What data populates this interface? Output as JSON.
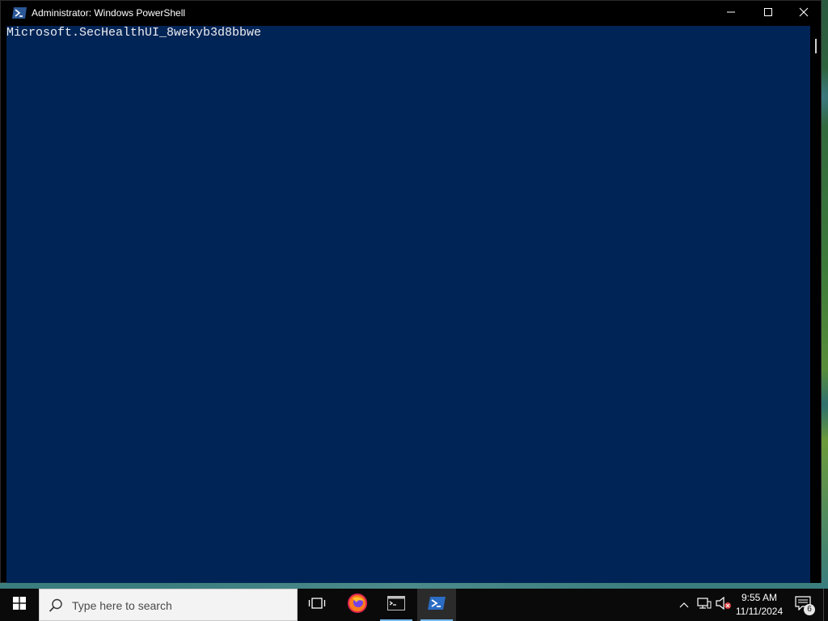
{
  "window": {
    "title": "Administrator: Windows PowerShell",
    "icon": "powershell-icon",
    "controls": [
      "minimize-icon",
      "maximize-icon",
      "close-icon"
    ]
  },
  "console": {
    "background": "#012456",
    "text_color": "#eeedf0",
    "lines": [
      "Microsoft.SecHealthUI_8wekyb3d8bbwe"
    ]
  },
  "taskbar": {
    "search_placeholder": "Type here to search",
    "apps": [
      {
        "name": "task-view-icon"
      },
      {
        "name": "firefox-icon"
      },
      {
        "name": "command-prompt-icon"
      },
      {
        "name": "powershell-icon",
        "active": true
      }
    ],
    "tray": {
      "icons": [
        "chevron-up-icon",
        "network-icon",
        "volume-muted-icon"
      ],
      "time": "9:55 AM",
      "date": "11/11/2024",
      "notification_count": "6"
    }
  },
  "colors": {
    "accent": "#76b9ed",
    "titlebar": "#000000",
    "taskbar": "#0a0a0a"
  }
}
